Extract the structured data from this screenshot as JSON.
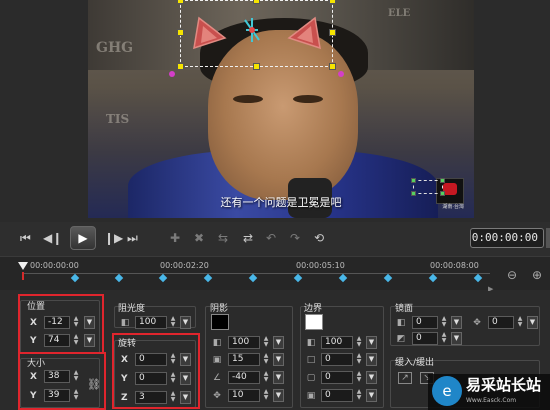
{
  "preview": {
    "subtitle": "还有一个问题是卫冕是吧",
    "logo_caption": "湖南·台灣"
  },
  "transport": {
    "timecode": "0:00:00:00",
    "buttons": [
      "start-icon",
      "prev-frame-icon",
      "play-icon",
      "next-frame-icon",
      "end-icon"
    ],
    "tools": [
      "add-keyframe-icon",
      "remove-keyframe-icon",
      "reverse-icon",
      "fade-icon",
      "prev-keyframe-icon",
      "next-keyframe-icon",
      "reset-icon"
    ]
  },
  "ruler": {
    "ticks": [
      "00:00:00:00",
      "00:00:02:20",
      "00:00:05:10",
      "00:00:08:00"
    ]
  },
  "panel": {
    "position": {
      "title": "位置",
      "x_label": "X",
      "x": "-12",
      "y_label": "Y",
      "y": "74"
    },
    "size": {
      "title": "大小",
      "x_label": "X",
      "x": "38",
      "y_label": "Y",
      "y": "39"
    },
    "opacity": {
      "title": "阻光度",
      "value": "100"
    },
    "rotation": {
      "title": "旋转",
      "x_label": "X",
      "x": "0",
      "y_label": "Y",
      "y": "0",
      "z_label": "Z",
      "z": "3"
    },
    "shadow": {
      "title": "阴影",
      "opacity": "100",
      "distance": "15",
      "angle": "-40",
      "blur": "10"
    },
    "border": {
      "title": "边界",
      "opacity": "100",
      "width": "0",
      "v2": "0",
      "v3": "0"
    },
    "mirror": {
      "title": "镜面",
      "v1": "0",
      "v2": "0",
      "v3": "0",
      "v4": "0"
    },
    "fade": {
      "title": "缓入/缓出"
    }
  },
  "watermark": {
    "title": "易采站长站",
    "subtitle": "Www.Easck.Com"
  },
  "colors": {
    "accent_red": "#e0252d",
    "keyframe": "#49b7e8",
    "ear": "#c9504e"
  }
}
